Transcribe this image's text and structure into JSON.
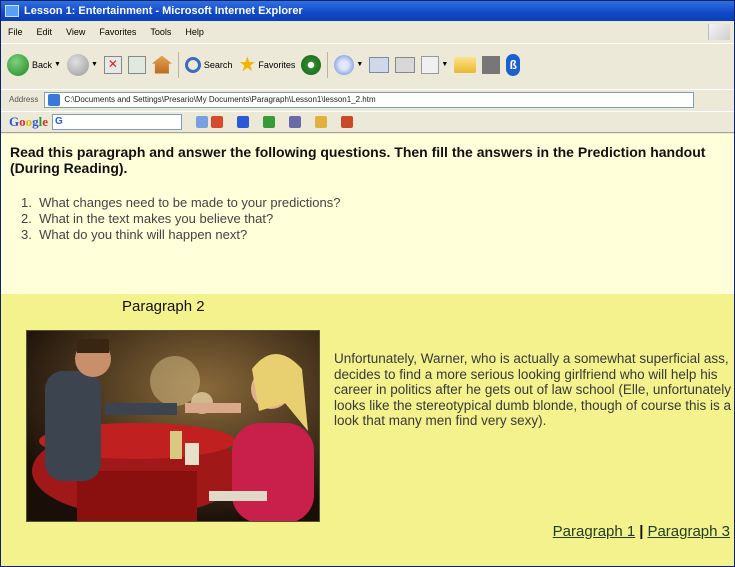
{
  "window": {
    "title": "Lesson 1: Entertainment - Microsoft Internet Explorer"
  },
  "menu": [
    "File",
    "Edit",
    "View",
    "Favorites",
    "Tools",
    "Help"
  ],
  "toolbar": {
    "back_label": "Back",
    "search_label": "Search",
    "favorites_label": "Favorites"
  },
  "address": {
    "label": "Address",
    "url": "C:\\Documents and Settings\\Presario\\My Documents\\Paragraph\\Lesson1\\lesson1_2.htm"
  },
  "google_bar": {
    "logo": [
      "G",
      "o",
      "o",
      "g",
      "l",
      "e"
    ],
    "search_value": "G"
  },
  "content": {
    "instructions": "Read this paragraph and answer the following questions. Then fill the answers in the Prediction handout (During Reading).",
    "questions": [
      "What changes need to be made to your predictions?",
      "What in the text makes you believe that?",
      "What do you think will happen next?"
    ],
    "paragraph_heading": "Paragraph 2",
    "paragraph_text": "Unfortunately, Warner, who is actually a somewhat superficial ass, decides to find a more serious looking girlfriend who will help his career in politics after he gets out of law school (Elle, unfortunately looks like the stereotypical dumb blonde, though of course this is a look that many men find very sexy).",
    "nav": {
      "prev_label": "Paragraph 1",
      "separator": "|",
      "next_label": "Paragraph 3"
    }
  },
  "colors": {
    "titlebar": "#1048c8",
    "content_upper_bg": "#ffffd9",
    "content_lower_bg": "#f4f28c"
  }
}
